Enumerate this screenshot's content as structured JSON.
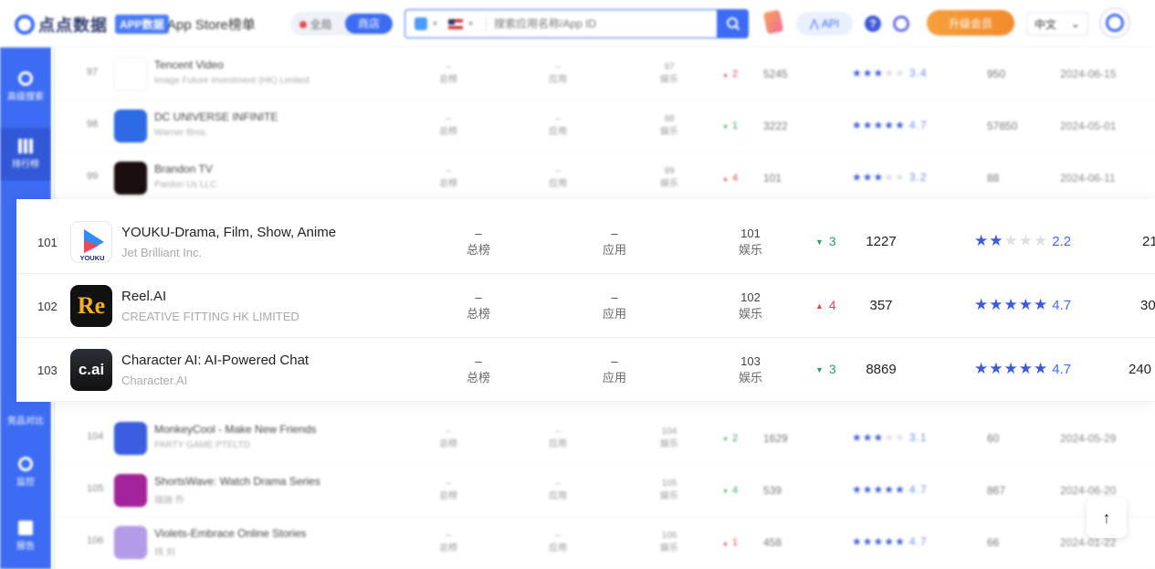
{
  "header": {
    "logo_text": "点点数据",
    "app_badge": "APP数据",
    "app_title": "App Store榜单",
    "scope_all": "全局",
    "scope_store": "商店",
    "search_placeholder": "搜索应用名称/App ID",
    "api_label": "API",
    "help_label": "?",
    "upgrade_label": "升级会员",
    "language": "中文"
  },
  "sidebar": [
    {
      "label": "高级搜索",
      "icon": "search-icon"
    },
    {
      "label": "排行榜",
      "icon": "bar-chart-icon",
      "active": true
    },
    {
      "label": "竞品对比",
      "icon": "compare-icon"
    },
    {
      "label": "监控",
      "icon": "monitor-icon"
    },
    {
      "label": "报告",
      "icon": "bookmark-icon"
    }
  ],
  "rows_top": [
    {
      "rank": "97",
      "name": "Tencent Video",
      "developer": "Image Future Investment (HK) Limited",
      "overall": "–",
      "overall_label": "总榜",
      "app": "–",
      "app_label": "应用",
      "category_rank": "97",
      "category": "娱乐",
      "change": "2",
      "direction": "up",
      "count": "5245",
      "stars": 3.5,
      "rating": "3.4",
      "ratings_count": "950",
      "date": "2024-06-15",
      "icon_color": "#ffffff"
    },
    {
      "rank": "98",
      "name": "DC UNIVERSE INFINITE",
      "developer": "Warner Bros.",
      "overall": "–",
      "overall_label": "总榜",
      "app": "–",
      "app_label": "应用",
      "category_rank": "98",
      "category": "娱乐",
      "change": "1",
      "direction": "down",
      "count": "3222",
      "stars": 5,
      "rating": "4.7",
      "ratings_count": "57850",
      "date": "2024-05-01",
      "icon_color": "#2d6be4"
    },
    {
      "rank": "99",
      "name": "Brandon TV",
      "developer": "Pardon Us LLC",
      "overall": "–",
      "overall_label": "总榜",
      "app": "–",
      "app_label": "应用",
      "category_rank": "99",
      "category": "娱乐",
      "change": "4",
      "direction": "up",
      "count": "101",
      "stars": 3,
      "rating": "3.2",
      "ratings_count": "88",
      "date": "2024-06-11",
      "icon_color": "#1a0e0e"
    }
  ],
  "rows_focus": [
    {
      "rank": "101",
      "name": "YOUKU-Drama, Film, Show, Anime",
      "developer": "Jet Brilliant Inc.",
      "overall": "–",
      "overall_label": "总榜",
      "app": "–",
      "app_label": "应用",
      "category_rank": "101",
      "category": "娱乐",
      "change": "3",
      "direction": "down",
      "count": "1227",
      "stars": 2,
      "rating": "2.2",
      "extra": "21",
      "icon_label": "YOUKU"
    },
    {
      "rank": "102",
      "name": "Reel.AI",
      "developer": "CREATIVE FITTING HK LIMITED",
      "overall": "–",
      "overall_label": "总榜",
      "app": "–",
      "app_label": "应用",
      "category_rank": "102",
      "category": "娱乐",
      "change": "4",
      "direction": "up",
      "count": "357",
      "stars": 5,
      "rating": "4.7",
      "extra": "30",
      "icon_label": "Re"
    },
    {
      "rank": "103",
      "name": "Character AI: AI-Powered Chat",
      "developer": "Character.AI",
      "overall": "–",
      "overall_label": "总榜",
      "app": "–",
      "app_label": "应用",
      "category_rank": "103",
      "category": "娱乐",
      "change": "3",
      "direction": "down",
      "count": "8869",
      "stars": 5,
      "rating": "4.7",
      "extra": "240",
      "icon_label": "c.ai"
    }
  ],
  "rows_bottom": [
    {
      "rank": "104",
      "name": "MonkeyCool - Make New Friends",
      "developer": "PARTY GAME PTELTD",
      "overall": "–",
      "overall_label": "总榜",
      "app": "–",
      "app_label": "应用",
      "category_rank": "104",
      "category": "娱乐",
      "change": "2",
      "direction": "down",
      "count": "1629",
      "stars": 3,
      "rating": "3.1",
      "ratings_count": "60",
      "date": "2024-05-29",
      "icon_color": "#3b5de0"
    },
    {
      "rank": "105",
      "name": "ShortsWave: Watch Drama Series",
      "developer": "瑞驰 乔",
      "overall": "–",
      "overall_label": "总榜",
      "app": "–",
      "app_label": "应用",
      "category_rank": "105",
      "category": "娱乐",
      "change": "4",
      "direction": "down",
      "count": "539",
      "stars": 5,
      "rating": "4.7",
      "ratings_count": "867",
      "date": "2024-06-20",
      "icon_color": "#a3239b"
    },
    {
      "rank": "106",
      "name": "Violets-Embrace Online Stories",
      "developer": "玮 刘",
      "overall": "–",
      "overall_label": "总榜",
      "app": "–",
      "app_label": "应用",
      "category_rank": "106",
      "category": "娱乐",
      "change": "1",
      "direction": "up",
      "count": "458",
      "stars": 5,
      "rating": "4.7",
      "ratings_count": "66",
      "date": "2024-01-22",
      "icon_color": "#b49be8"
    }
  ],
  "back_to_top": "↑",
  "colors": {
    "accent": "#3d6cf2",
    "up": "#e0474c",
    "down": "#2aa55a",
    "star": "#3d5bd9"
  }
}
